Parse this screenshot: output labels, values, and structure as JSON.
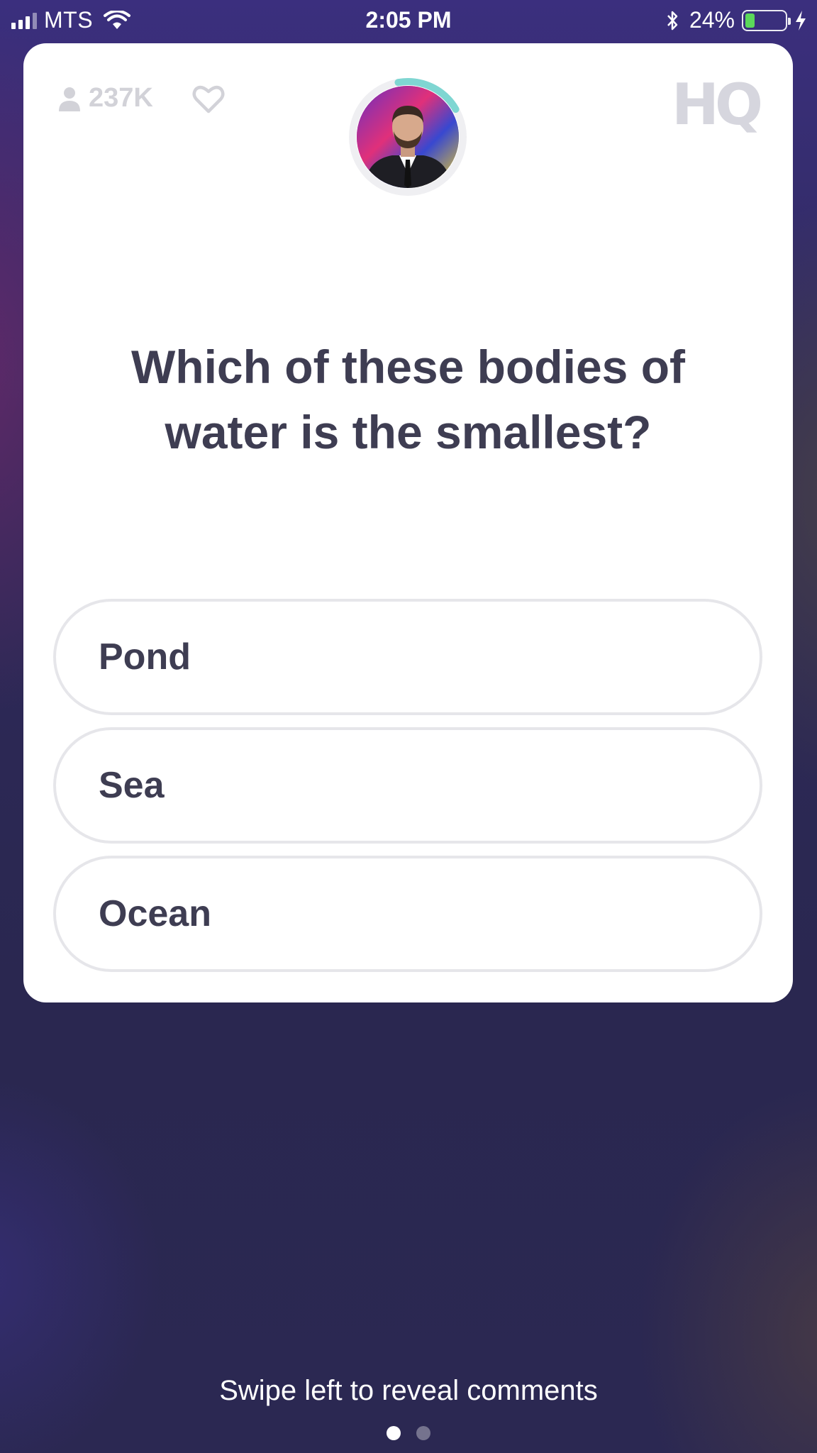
{
  "status_bar": {
    "carrier": "MTS",
    "time": "2:05 PM",
    "battery_percent": "24%",
    "battery_level": 0.24
  },
  "header": {
    "viewer_count": "237K",
    "logo": "HQ",
    "icons": [
      "person-icon",
      "heart-icon"
    ]
  },
  "question": {
    "text": "Which of these bodies of water is the smallest?"
  },
  "answers": [
    {
      "label": "Pond"
    },
    {
      "label": "Sea"
    },
    {
      "label": "Ocean"
    }
  ],
  "footer": {
    "hint": "Swipe left to reveal comments",
    "page_count": 2,
    "active_page": 1
  },
  "colors": {
    "accent_ring": "#7fd6d2",
    "question_text": "#3e3d52",
    "answer_border": "#e6e6ea",
    "battery_fill": "#5bd85a"
  }
}
